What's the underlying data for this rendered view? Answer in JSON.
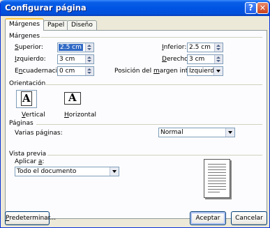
{
  "window": {
    "title": "Configurar página",
    "help_glyph": "?",
    "close_glyph": "✕"
  },
  "tabs": [
    {
      "label": "Márgenes"
    },
    {
      "label": "Papel"
    },
    {
      "label": "Diseño"
    }
  ],
  "margins": {
    "group_label": "Márgenes",
    "top": {
      "label_key": "S",
      "label_rest": "uperior:",
      "value": "2.5 cm"
    },
    "left": {
      "label_key": "I",
      "label_rest": "zquierdo:",
      "value": "3 cm"
    },
    "gutter": {
      "label_pre": "E",
      "label_key": "n",
      "label_rest": "cuadernación:",
      "value": "0 cm"
    },
    "bottom": {
      "label_key": "I",
      "label_rest": "nferior:",
      "value": "2.5 cm"
    },
    "right": {
      "label_key": "D",
      "label_rest": "erecho:",
      "value": "3 cm"
    },
    "gutter_position": {
      "label_pre": "Posición del ",
      "label_key": "m",
      "label_rest": "argen interno:",
      "value": "Izquierda"
    }
  },
  "orientation": {
    "group_label": "Orientación",
    "selected": "Vertical",
    "portrait": {
      "label_key": "V",
      "label_rest": "ertical",
      "glyph": "A"
    },
    "landscape": {
      "label_key": "H",
      "label_rest": "orizontal",
      "glyph": "A"
    }
  },
  "pages": {
    "group_label": "Páginas",
    "multiple_label_pre": "Varias pá",
    "multiple_label_key": "g",
    "multiple_label_rest": "inas:",
    "multiple_value": "Normal"
  },
  "preview": {
    "group_label": "Vista previa",
    "apply_to_label_pre": "Aplicar ",
    "apply_to_label_key": "a",
    "apply_to_label_rest": ":",
    "apply_to_value": "Todo el documento"
  },
  "buttons": {
    "default_key": "P",
    "default_rest": "redeterminar...",
    "ok": "Aceptar",
    "cancel": "Cancelar"
  },
  "colors": {
    "titlebar": "#0054e3",
    "dialog_bg": "#ece9d8",
    "selection": "#316ac5",
    "tab_highlight": "#ffc83c"
  },
  "icons": [
    "help-icon",
    "close-icon",
    "portrait-page-icon",
    "landscape-page-icon",
    "page-preview-icon"
  ]
}
